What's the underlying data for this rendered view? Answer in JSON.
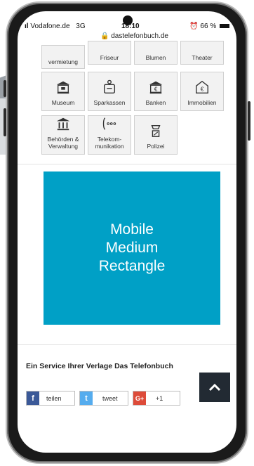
{
  "status_bar": {
    "carrier": "Vodafone.de",
    "network": "3G",
    "time": "18:10",
    "battery": "66 %",
    "url": "dastelefonbuch.de"
  },
  "tiles_top": [
    {
      "label": "vermietung"
    },
    {
      "label": "Friseur"
    },
    {
      "label": "Blumen"
    },
    {
      "label": "Theater"
    }
  ],
  "tiles_row1": [
    {
      "label": "Museum",
      "icon": "museum-icon"
    },
    {
      "label": "Sparkassen",
      "icon": "savings-bank-icon"
    },
    {
      "label": "Banken",
      "icon": "bank-icon"
    },
    {
      "label": "Immobilien",
      "icon": "real-estate-icon"
    }
  ],
  "tiles_row2": [
    {
      "label": "Behörden & Verwaltung",
      "icon": "authority-icon"
    },
    {
      "label": "Telekom-munikation",
      "icon": "telephone-icon"
    },
    {
      "label": "Polizei",
      "icon": "police-icon"
    }
  ],
  "ad": {
    "line1": "Mobile",
    "line2": "Medium",
    "line3": "Rectangle"
  },
  "footer": {
    "service_text": "Ein Service Ihrer Verlage Das Telefonbuch"
  },
  "share": {
    "facebook": {
      "label": "teilen",
      "icon": "facebook-icon",
      "color": "#3b5998"
    },
    "twitter": {
      "label": "tweet",
      "icon": "twitter-icon",
      "color": "#55acee"
    },
    "gplus": {
      "label": "+1",
      "icon": "google-plus-icon",
      "color": "#dd4b39"
    }
  },
  "colors": {
    "ad_bg": "#00a0c6",
    "scroll_top_bg": "#222a33"
  }
}
